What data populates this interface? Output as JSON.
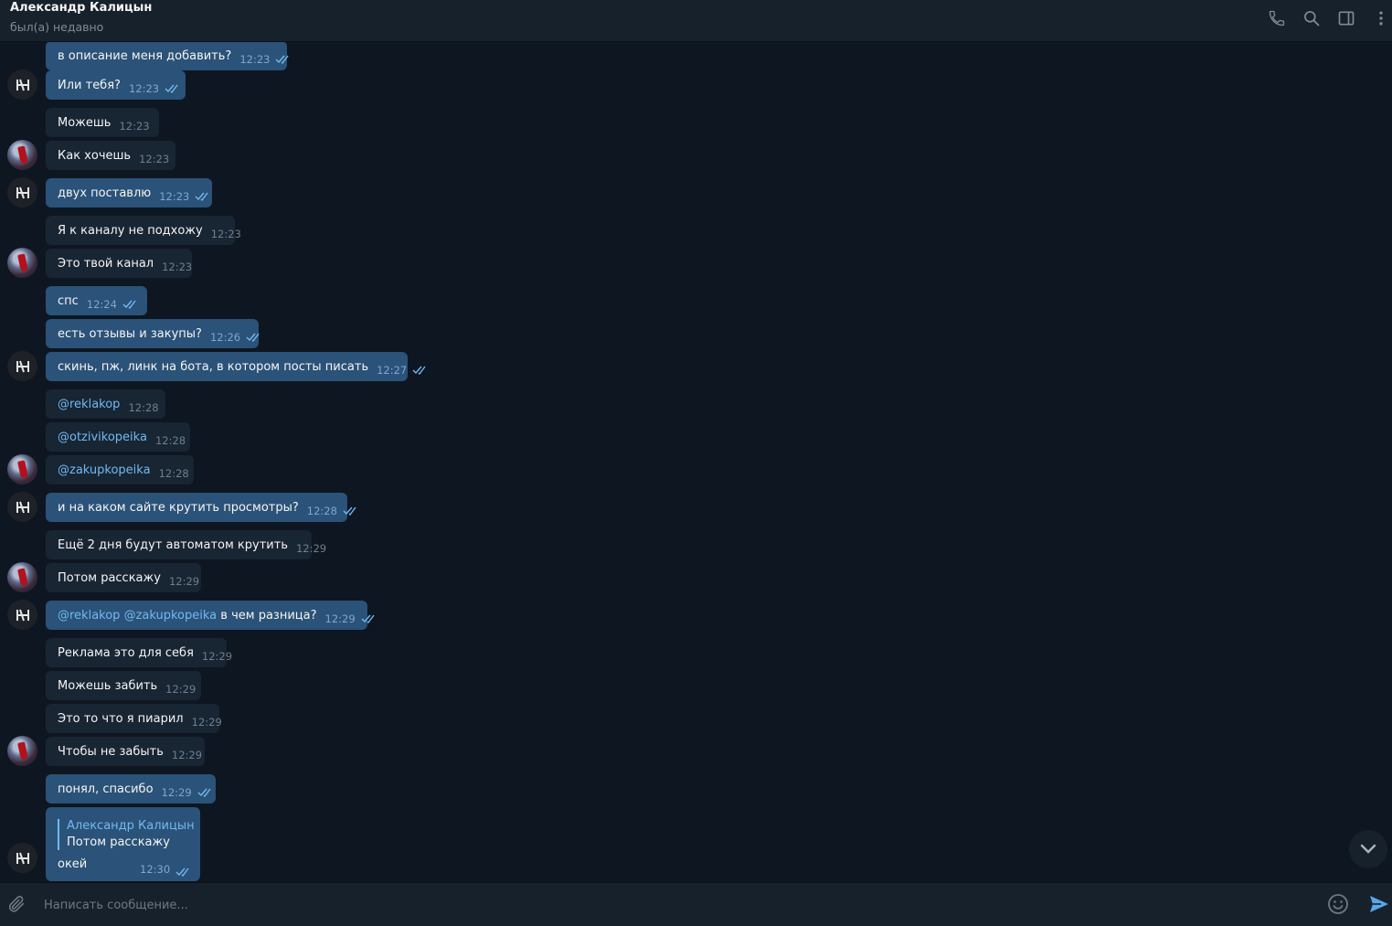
{
  "header": {
    "contact_name": "Александр Калицын",
    "status": "был(а) недавно",
    "icons": [
      "phone-icon",
      "search-icon",
      "sidebar-toggle-icon",
      "more-vertical-icon"
    ]
  },
  "messages": [
    {
      "dir": "out",
      "text": "в описание меня добавить?",
      "time": "12:23",
      "read": true
    },
    {
      "dir": "out",
      "text": "Или тебя?",
      "time": "12:23",
      "read": true
    },
    {
      "dir": "in",
      "text": "Можешь",
      "time": "12:23"
    },
    {
      "dir": "in",
      "text": "Как хочешь",
      "time": "12:23"
    },
    {
      "dir": "out",
      "text": "двух поставлю",
      "time": "12:23",
      "read": true
    },
    {
      "dir": "in",
      "text": "Я к каналу не подхожу",
      "time": "12:23"
    },
    {
      "dir": "in",
      "text": "Это твой канал",
      "time": "12:23"
    },
    {
      "dir": "out",
      "text": "спс",
      "time": "12:24",
      "read": true
    },
    {
      "dir": "out",
      "text": "есть отзывы и закупы?",
      "time": "12:26",
      "read": true
    },
    {
      "dir": "out",
      "text": "скинь, пж, линк на бота, в котором посты писать",
      "time": "12:27",
      "read": true
    },
    {
      "dir": "in",
      "text": "@reklakop",
      "time": "12:28"
    },
    {
      "dir": "in",
      "text": "@otzivikopeika",
      "time": "12:28"
    },
    {
      "dir": "in",
      "text": "@zakupkopeika",
      "time": "12:28"
    },
    {
      "dir": "out",
      "text": "и на каком сайте крутить просмотры?",
      "time": "12:28",
      "read": true
    },
    {
      "dir": "in",
      "text": "Ещё 2 дня будут автоматом крутить",
      "time": "12:29"
    },
    {
      "dir": "in",
      "text": "Потом расскажу",
      "time": "12:29"
    },
    {
      "dir": "out",
      "mentions": [
        "@reklakop",
        "@zakupkopeika"
      ],
      "text": "в чем разница?",
      "time": "12:29",
      "read": true
    },
    {
      "dir": "in",
      "text": "Реклама это для себя",
      "time": "12:29"
    },
    {
      "dir": "in",
      "text": "Можешь забить",
      "time": "12:29"
    },
    {
      "dir": "in",
      "text": "Это то что я пиарил",
      "time": "12:29"
    },
    {
      "dir": "in",
      "text": "Чтобы не забыть",
      "time": "12:29"
    },
    {
      "dir": "out",
      "text": "понял, спасибо",
      "time": "12:29",
      "read": true
    }
  ],
  "reply_message": {
    "quoted_name": "Александр Калицын",
    "quoted_text": "Потом расскажу",
    "text": "окей",
    "time": "12:30",
    "read": true
  },
  "composer": {
    "placeholder": "Написать сообщение...",
    "icons": [
      "paperclip-icon",
      "emoji-icon",
      "send-icon"
    ]
  },
  "colors": {
    "background": "#0e1621",
    "header": "#17212b",
    "outgoing_bubble": "#2b5278",
    "incoming_bubble": "#182533",
    "link": "#71baf2",
    "time_out": "#7da8d3",
    "time_in": "#6d7f8f"
  }
}
